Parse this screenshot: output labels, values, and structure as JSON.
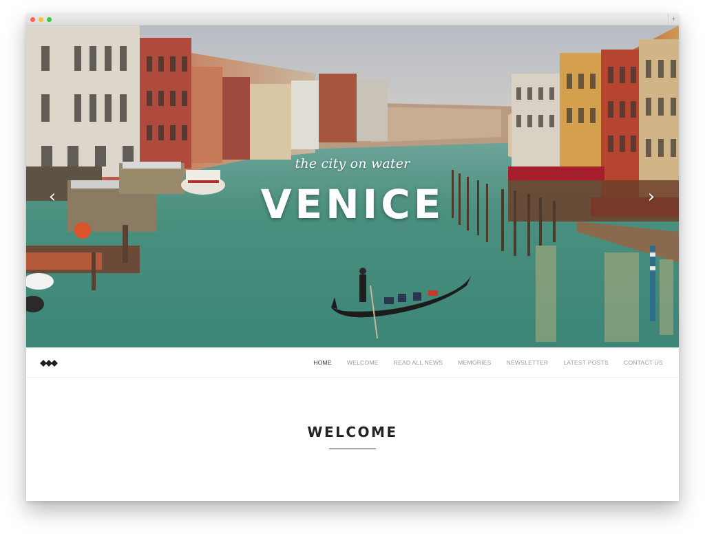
{
  "hero": {
    "tagline": "the city on water",
    "title": "VENICE",
    "prev_arrow": "‹",
    "next_arrow": "›"
  },
  "nav": {
    "items": [
      {
        "label": "HOME",
        "active": true
      },
      {
        "label": "WELCOME",
        "active": false
      },
      {
        "label": "READ ALL NEWS",
        "active": false
      },
      {
        "label": "MEMORIES",
        "active": false
      },
      {
        "label": "NEWSLETTER",
        "active": false
      },
      {
        "label": "LATEST POSTS",
        "active": false
      },
      {
        "label": "CONTACT US",
        "active": false
      }
    ]
  },
  "welcome": {
    "heading": "WELCOME"
  },
  "browser": {
    "new_tab": "+"
  },
  "icons": {
    "logo": "diamond-logo-icon",
    "prev": "chevron-left-icon",
    "next": "chevron-right-icon"
  },
  "colors": {
    "nav_active": "#333333",
    "nav_inactive": "#9a9a9a",
    "heading": "#222222",
    "canal_water": "#3f8a7c"
  }
}
